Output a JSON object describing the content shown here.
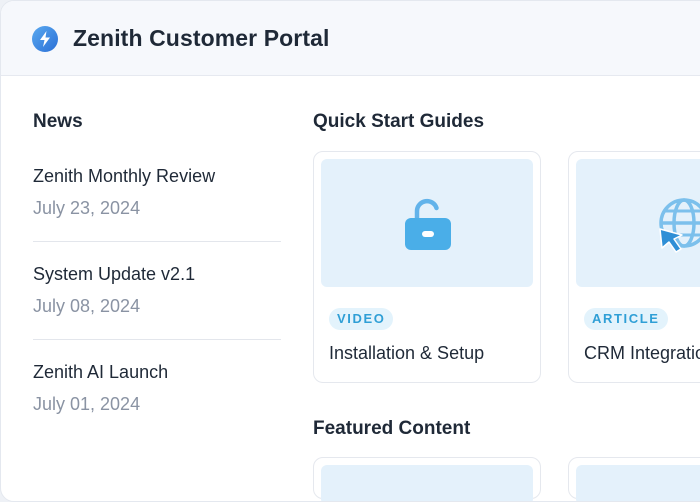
{
  "app": {
    "title": "Zenith Customer Portal",
    "logo_icon": "lightning-bolt-icon"
  },
  "news": {
    "heading": "News",
    "items": [
      {
        "title": "Zenith Monthly Review",
        "date": "July 23, 2024"
      },
      {
        "title": "System Update v2.1",
        "date": "July 08, 2024"
      },
      {
        "title": "Zenith AI Launch",
        "date": "July 01, 2024"
      }
    ]
  },
  "guides": {
    "heading": "Quick Start Guides",
    "cards": [
      {
        "badge": "VIDEO",
        "title": "Installation & Setup",
        "icon": "unlock-icon"
      },
      {
        "badge": "ARTICLE",
        "title": "CRM Integration",
        "icon": "globe-cursor-icon"
      }
    ]
  },
  "featured": {
    "heading": "Featured Content"
  },
  "colors": {
    "accent": "#2f9fd6",
    "logo": "#3b8fe0",
    "thumb_bg": "#e4f1fb"
  }
}
